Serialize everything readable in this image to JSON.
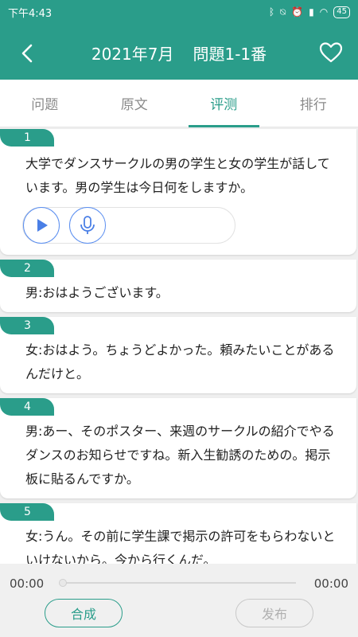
{
  "status_bar": {
    "time": "下午4:43",
    "battery": "45"
  },
  "header": {
    "title_date": "2021年7月",
    "title_question": "問題1-1番"
  },
  "tabs": [
    {
      "label": "问题",
      "active": false
    },
    {
      "label": "原文",
      "active": false
    },
    {
      "label": "评测",
      "active": true
    },
    {
      "label": "排行",
      "active": false
    }
  ],
  "sentences": [
    {
      "num": "1",
      "text": "大学でダンスサークルの男の学生と女の学生が話しています。男の学生は今日何をしますか。"
    },
    {
      "num": "2",
      "text": "男:おはようございます。"
    },
    {
      "num": "3",
      "text": "女:おはよう。ちょうどよかった。頼みたいことがあるんだけと。"
    },
    {
      "num": "4",
      "text": "男:あー、そのポスター、来週のサークルの紹介でやるダンスのお知らせですね。新入生勧誘のための。掲示板に貼るんですか。"
    },
    {
      "num": "5",
      "text": "女:うん。その前に学生課で掲示の許可をもらわないといけないから。今から行くんだ。"
    },
    {
      "num": "6",
      "text": ""
    }
  ],
  "player": {
    "current_time": "00:00",
    "total_time": "00:00",
    "progress": 0
  },
  "actions": {
    "compose_label": "合成",
    "publish_label": "发布"
  },
  "colors": {
    "accent": "#2a9d8a",
    "mic_blue": "#5a8ef0"
  }
}
